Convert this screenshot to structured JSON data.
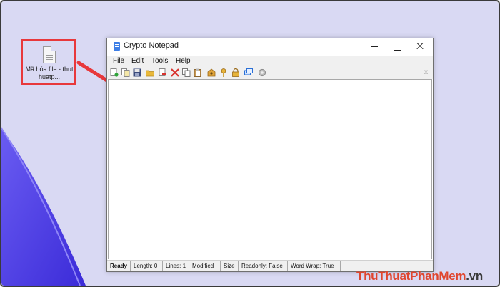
{
  "desktop": {
    "file_icon_label": "Mã hóa file - thuthuatp..."
  },
  "window": {
    "title": "Crypto Notepad",
    "menu": [
      "File",
      "Edit",
      "Tools",
      "Help"
    ],
    "toolbar_close": "x",
    "toolbar_icons": [
      "new-file-icon",
      "copy-file-icon",
      "save-icon",
      "open-folder-icon",
      "delete-file-icon",
      "cut-icon",
      "copy-icon",
      "paste-icon",
      "encrypt-icon",
      "key-icon",
      "lock-icon",
      "windows-icon",
      "settings-icon"
    ],
    "editor_text": ""
  },
  "statusbar": {
    "ready": "Ready",
    "length": "Length: 0",
    "lines": "Lines: 1",
    "modified": "Modified",
    "size": "Size",
    "readonly": "Readonly: False",
    "word_wrap": "Word Wrap: True"
  },
  "watermark": {
    "part1": "Thu",
    "part2": "Thuat",
    "part3": "PhanMem",
    "part4": ".vn"
  },
  "colors": {
    "desktop_bg": "#d9d9f3",
    "highlight_red": "#e8383b",
    "accent_purple": "#4b3df0"
  }
}
